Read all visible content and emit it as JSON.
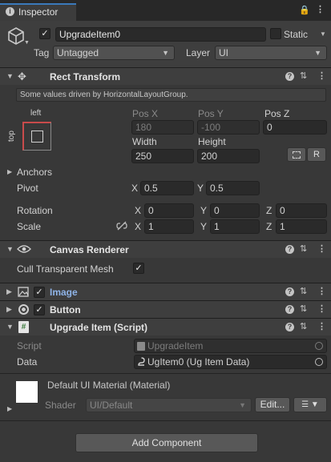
{
  "tab": {
    "title": "Inspector"
  },
  "object": {
    "name": "UpgradeItem0",
    "static_label": "Static",
    "tag_label": "Tag",
    "tag_value": "Untagged",
    "layer_label": "Layer",
    "layer_value": "UI",
    "active_checked": true,
    "static_checked": false
  },
  "rect_transform": {
    "title": "Rect Transform",
    "driven_note": "Some values driven by HorizontalLayoutGroup.",
    "anchor_h": "left",
    "anchor_v": "top",
    "pos_x_label": "Pos X",
    "pos_y_label": "Pos Y",
    "pos_z_label": "Pos Z",
    "pos_x": "180",
    "pos_y": "-100",
    "pos_z": "0",
    "width_label": "Width",
    "height_label": "Height",
    "width": "250",
    "height": "200",
    "r_button": "R",
    "anchors_label": "Anchors",
    "pivot_label": "Pivot",
    "pivot_x": "0.5",
    "pivot_y": "0.5",
    "rotation_label": "Rotation",
    "rotation": [
      "0",
      "0",
      "0"
    ],
    "scale_label": "Scale",
    "scale": [
      "1",
      "1",
      "1"
    ],
    "axis": [
      "X",
      "Y",
      "Z"
    ]
  },
  "canvas_renderer": {
    "title": "Canvas Renderer",
    "cull_label": "Cull Transparent Mesh",
    "cull_checked": true
  },
  "image": {
    "title": "Image",
    "enabled": true
  },
  "button": {
    "title": "Button",
    "enabled": true
  },
  "upgrade_item": {
    "title": "Upgrade Item (Script)",
    "script_label": "Script",
    "script_value": "UpgradeItem",
    "data_label": "Data",
    "data_value": "UgItem0 (Ug Item Data)"
  },
  "material": {
    "title": "Default UI Material (Material)",
    "shader_label": "Shader",
    "shader_value": "UI/Default",
    "edit_button": "Edit..."
  },
  "add_component": {
    "label": "Add Component"
  },
  "colors": {
    "background": "#383838",
    "header": "#3e3e3e",
    "field": "#2a2a2a",
    "text": "#d2d2d2",
    "image_title": "#8fb4e8"
  }
}
